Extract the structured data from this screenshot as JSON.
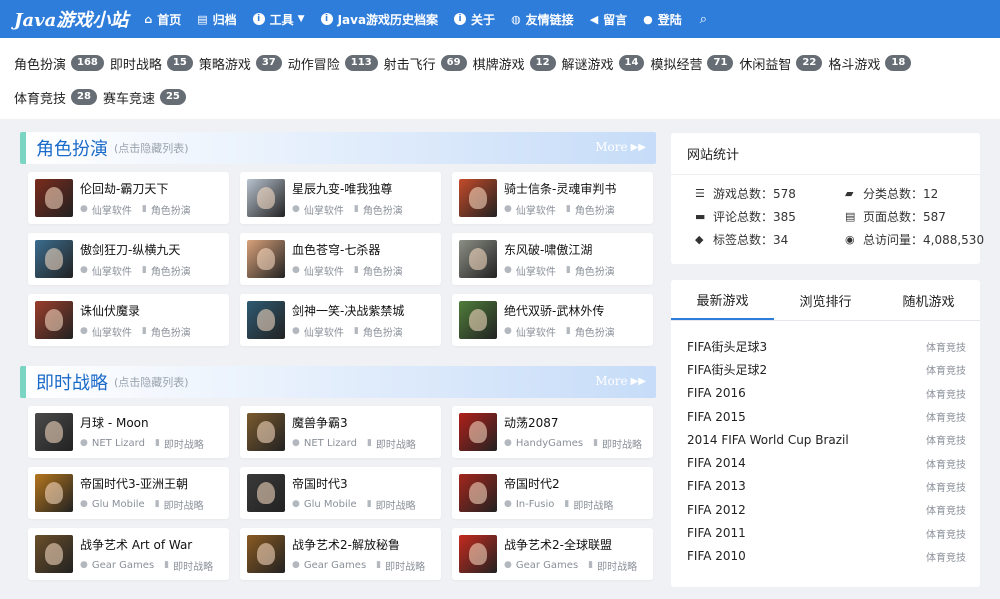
{
  "nav": {
    "brand": "Java游戏小站",
    "items": [
      {
        "icon": "home-icon",
        "glyph": "⌂",
        "label": "首页"
      },
      {
        "icon": "archive-icon",
        "glyph": "▤",
        "label": "归档"
      },
      {
        "icon": "info-icon",
        "glyph": "i",
        "label": "工具",
        "dropdown": true
      },
      {
        "icon": "info-icon",
        "glyph": "i",
        "label": "Java游戏历史档案"
      },
      {
        "icon": "info-icon",
        "glyph": "i",
        "label": "关于"
      },
      {
        "icon": "globe-icon",
        "glyph": "◍",
        "label": "友情链接"
      },
      {
        "icon": "megaphone-icon",
        "glyph": "◀",
        "label": "留言"
      },
      {
        "icon": "user-icon",
        "glyph": "●",
        "label": "登陆"
      }
    ],
    "search_icon": "search-icon"
  },
  "categories": [
    {
      "label": "角色扮演",
      "count": "168"
    },
    {
      "label": "即时战略",
      "count": "15"
    },
    {
      "label": "策略游戏",
      "count": "37"
    },
    {
      "label": "动作冒险",
      "count": "113"
    },
    {
      "label": "射击飞行",
      "count": "69"
    },
    {
      "label": "棋牌游戏",
      "count": "12"
    },
    {
      "label": "解谜游戏",
      "count": "14"
    },
    {
      "label": "模拟经营",
      "count": "71"
    },
    {
      "label": "休闲益智",
      "count": "22"
    },
    {
      "label": "格斗游戏",
      "count": "18"
    },
    {
      "label": "体育竞技",
      "count": "28"
    },
    {
      "label": "赛车竞速",
      "count": "25"
    }
  ],
  "sections": [
    {
      "title": "角色扮演",
      "hint": "(点击隐藏列表)",
      "more": "More",
      "games": [
        {
          "title": "伦回劫-霸刀天下",
          "author": "仙掌软件",
          "category": "角色扮演",
          "color": "#7a2b1c"
        },
        {
          "title": "星辰九变-唯我独尊",
          "author": "仙掌软件",
          "category": "角色扮演",
          "color": "#b8c3cf"
        },
        {
          "title": "骑士信条-灵魂审判书",
          "author": "仙掌软件",
          "category": "角色扮演",
          "color": "#c44b2a"
        },
        {
          "title": "傲剑狂刀-纵横九天",
          "author": "仙掌软件",
          "category": "角色扮演",
          "color": "#3b6d8e"
        },
        {
          "title": "血色苍穹-七杀器",
          "author": "仙掌软件",
          "category": "角色扮演",
          "color": "#d9a27a"
        },
        {
          "title": "东风破-啸傲江湖",
          "author": "仙掌软件",
          "category": "角色扮演",
          "color": "#8c8f85"
        },
        {
          "title": "诛仙伏魔录",
          "author": "仙掌软件",
          "category": "角色扮演",
          "color": "#9a3e2c"
        },
        {
          "title": "剑神一笑-决战紫禁城",
          "author": "仙掌软件",
          "category": "角色扮演",
          "color": "#2e5a72"
        },
        {
          "title": "绝代双骄-武林外传",
          "author": "仙掌软件",
          "category": "角色扮演",
          "color": "#4f7d3a"
        }
      ]
    },
    {
      "title": "即时战略",
      "hint": "(点击隐藏列表)",
      "more": "More",
      "games": [
        {
          "title": "月球 - Moon",
          "author": "NET Lizard",
          "category": "即时战略",
          "color": "#4a4a4a"
        },
        {
          "title": "魔兽争霸3",
          "author": "NET Lizard",
          "category": "即时战略",
          "color": "#7a5a2e"
        },
        {
          "title": "动荡2087",
          "author": "HandyGames",
          "category": "即时战略",
          "color": "#b0201a"
        },
        {
          "title": "帝国时代3-亚洲王朝",
          "author": "Glu Mobile",
          "category": "即时战略",
          "color": "#b5761d"
        },
        {
          "title": "帝国时代3",
          "author": "Glu Mobile",
          "category": "即时战略",
          "color": "#3a3a3a"
        },
        {
          "title": "帝国时代2",
          "author": "In-Fusio",
          "category": "即时战略",
          "color": "#a3261c"
        },
        {
          "title": "战争艺术 Art of War",
          "author": "Gear Games",
          "category": "即时战略",
          "color": "#6b4f2a"
        },
        {
          "title": "战争艺术2-解放秘鲁",
          "author": "Gear Games",
          "category": "即时战略",
          "color": "#8a5a22"
        },
        {
          "title": "战争艺术2-全球联盟",
          "author": "Gear Games",
          "category": "即时战略",
          "color": "#c52a1e"
        }
      ]
    }
  ],
  "stats": {
    "title": "网站统计",
    "items": [
      {
        "icon": "list-icon",
        "glyph": "☰",
        "label": "游戏总数：578"
      },
      {
        "icon": "folder-icon",
        "glyph": "▰",
        "label": "分类总数：12"
      },
      {
        "icon": "comment-icon",
        "glyph": "▬",
        "label": "评论总数：385"
      },
      {
        "icon": "page-icon",
        "glyph": "▤",
        "label": "页面总数：587"
      },
      {
        "icon": "tag-icon",
        "glyph": "◆",
        "label": "标签总数：34"
      },
      {
        "icon": "eye-icon",
        "glyph": "◉",
        "label": "总访问量：4,088,530"
      }
    ]
  },
  "tabs": {
    "items": [
      "最新游戏",
      "浏览排行",
      "随机游戏"
    ],
    "active": 0,
    "list": [
      {
        "name": "FIFA街头足球3",
        "tag": "体育竞技"
      },
      {
        "name": "FIFA街头足球2",
        "tag": "体育竞技"
      },
      {
        "name": "FIFA 2016",
        "tag": "体育竞技"
      },
      {
        "name": "FIFA 2015",
        "tag": "体育竞技"
      },
      {
        "name": "2014 FIFA World Cup Brazil",
        "tag": "体育竞技"
      },
      {
        "name": "FIFA 2014",
        "tag": "体育竞技"
      },
      {
        "name": "FIFA 2013",
        "tag": "体育竞技"
      },
      {
        "name": "FIFA 2012",
        "tag": "体育竞技"
      },
      {
        "name": "FIFA 2011",
        "tag": "体育竞技"
      },
      {
        "name": "FIFA 2010",
        "tag": "体育竞技"
      }
    ]
  }
}
